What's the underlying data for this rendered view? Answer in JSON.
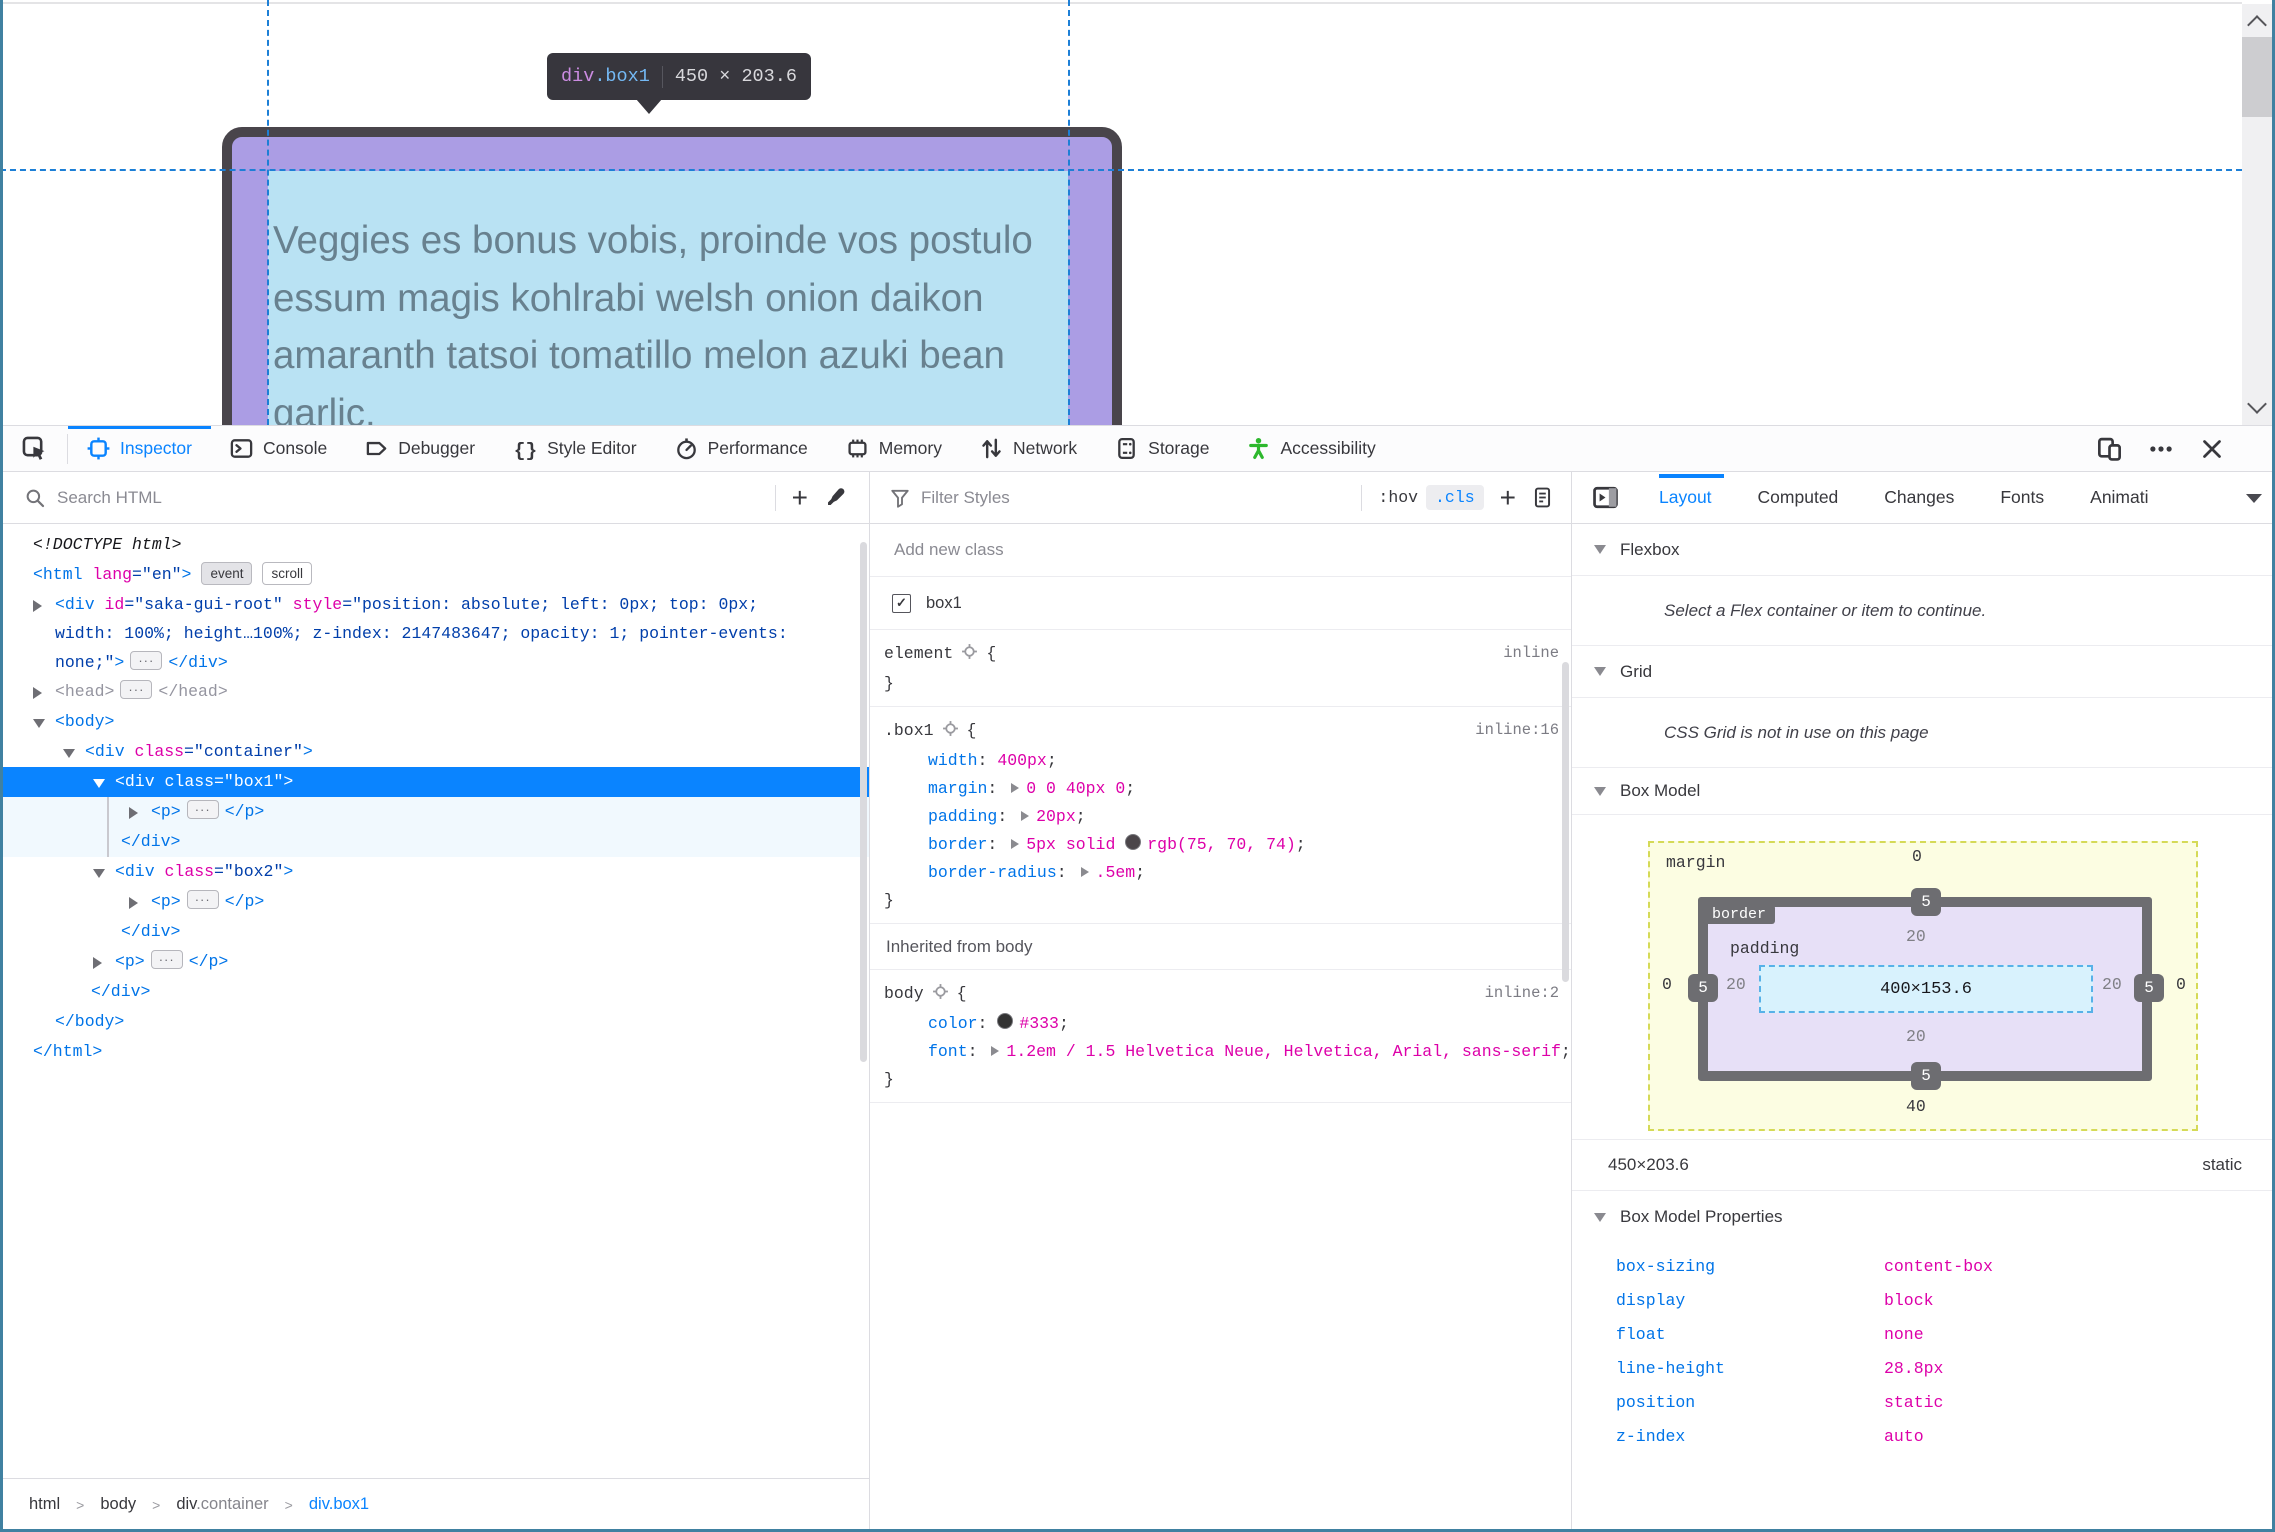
{
  "colors": {
    "accent": "#0a84ff",
    "tag_blue": "#0074e8",
    "attr_magenta": "#dd00a9",
    "value_navy": "#003eaa",
    "selection_bg": "#0a84ff",
    "guide_blue": "#1d7fd6",
    "highlight_padding": "#ab9de4",
    "highlight_content": "#b9e2f3",
    "element_border": "#4b464a",
    "window_edge": "#4081a1",
    "margin_fill": "#fcfde2",
    "padding_fill": "#e7e0f7",
    "content_fill": "#d8f2fd",
    "a11y_green": "#2db82d"
  },
  "page": {
    "tooltip": {
      "tag": "div",
      "class": ".box1",
      "dimensions": "450 × 203.6"
    },
    "box_text_lines": [
      "Veggies es bonus vobis, proinde vos postulo",
      "essum magis kohlrabi welsh onion daikon",
      "amaranth tatsoi tomatillo melon azuki bean",
      "garlic."
    ]
  },
  "tabbar": {
    "tabs": [
      {
        "id": "inspector",
        "label": "Inspector",
        "active": true
      },
      {
        "id": "console",
        "label": "Console",
        "active": false
      },
      {
        "id": "debugger",
        "label": "Debugger",
        "active": false
      },
      {
        "id": "style-editor",
        "label": "Style Editor",
        "active": false
      },
      {
        "id": "performance",
        "label": "Performance",
        "active": false
      },
      {
        "id": "memory",
        "label": "Memory",
        "active": false
      },
      {
        "id": "network",
        "label": "Network",
        "active": false
      },
      {
        "id": "storage",
        "label": "Storage",
        "active": false
      },
      {
        "id": "accessibility",
        "label": "Accessibility",
        "active": false
      }
    ]
  },
  "markup": {
    "search_placeholder": "Search HTML",
    "tree": [
      {
        "indent": 30,
        "parts": [
          {
            "k": "doctype",
            "v": "<!DOCTYPE html>"
          }
        ]
      },
      {
        "indent": 30,
        "parts": [
          {
            "k": "tag",
            "v": "<html"
          },
          {
            "k": "attr",
            "v": " lang"
          },
          {
            "k": "val",
            "v": "=\"en\""
          },
          {
            "k": "tag",
            "v": ">"
          },
          {
            "k": "badge",
            "v": "event"
          },
          {
            "k": "badge_o",
            "v": "scroll"
          }
        ]
      },
      {
        "indent": 52,
        "arrow": "c",
        "wrap": true,
        "parts": [
          {
            "k": "tag",
            "v": "<div"
          },
          {
            "k": "attr",
            "v": " id"
          },
          {
            "k": "val",
            "v": "=\"saka-gui-root\""
          },
          {
            "k": "attr",
            "v": " style"
          },
          {
            "k": "val",
            "v": "=\"position: absolute; left: 0px; top: 0px; width: 100%; height…100%; z-index: 2147483647; opacity: 1; pointer-events: none;\""
          },
          {
            "k": "tag",
            "v": ">"
          },
          {
            "k": "ellipsis"
          },
          {
            "k": "tag",
            "v": "</div>"
          }
        ]
      },
      {
        "indent": 52,
        "arrow": "c",
        "dim": true,
        "parts": [
          {
            "k": "tag",
            "v": "<head>"
          },
          {
            "k": "ellipsis"
          },
          {
            "k": "tag",
            "v": "</head>"
          }
        ]
      },
      {
        "indent": 52,
        "arrow": "e",
        "parts": [
          {
            "k": "tag",
            "v": "<body>"
          }
        ]
      },
      {
        "indent": 82,
        "arrow": "e",
        "parts": [
          {
            "k": "tag",
            "v": "<div"
          },
          {
            "k": "attr",
            "v": " class"
          },
          {
            "k": "val",
            "v": "=\"container\""
          },
          {
            "k": "tag",
            "v": ">"
          }
        ]
      },
      {
        "indent": 112,
        "arrow": "e",
        "sel": true,
        "parts": [
          {
            "k": "tag",
            "v": "<div"
          },
          {
            "k": "attr",
            "v": " class"
          },
          {
            "k": "val",
            "v": "=\"box1\""
          },
          {
            "k": "tag",
            "v": ">"
          }
        ]
      },
      {
        "indent": 148,
        "arrow": "c",
        "child": true,
        "parts": [
          {
            "k": "tag",
            "v": "<p>"
          },
          {
            "k": "ellipsis"
          },
          {
            "k": "tag",
            "v": "</p>"
          }
        ]
      },
      {
        "indent": 118,
        "child": true,
        "parts": [
          {
            "k": "tag",
            "v": "</div>"
          }
        ]
      },
      {
        "indent": 112,
        "arrow": "e",
        "parts": [
          {
            "k": "tag",
            "v": "<div"
          },
          {
            "k": "attr",
            "v": " class"
          },
          {
            "k": "val",
            "v": "=\"box2\""
          },
          {
            "k": "tag",
            "v": ">"
          }
        ]
      },
      {
        "indent": 148,
        "arrow": "c",
        "parts": [
          {
            "k": "tag",
            "v": "<p>"
          },
          {
            "k": "ellipsis"
          },
          {
            "k": "tag",
            "v": "</p>"
          }
        ]
      },
      {
        "indent": 118,
        "parts": [
          {
            "k": "tag",
            "v": "</div>"
          }
        ]
      },
      {
        "indent": 112,
        "arrow": "c",
        "parts": [
          {
            "k": "tag",
            "v": "<p>"
          },
          {
            "k": "ellipsis"
          },
          {
            "k": "tag",
            "v": "</p>"
          }
        ]
      },
      {
        "indent": 88,
        "parts": [
          {
            "k": "tag",
            "v": "</div>"
          }
        ]
      },
      {
        "indent": 52,
        "parts": [
          {
            "k": "tag",
            "v": "</body>"
          }
        ]
      },
      {
        "indent": 30,
        "parts": [
          {
            "k": "tag",
            "v": "</html>"
          }
        ]
      }
    ],
    "breadcrumbs": [
      {
        "tag": "html",
        "cls": "",
        "sel": false
      },
      {
        "tag": "body",
        "cls": "",
        "sel": false
      },
      {
        "tag": "div",
        "cls": ".container",
        "sel": false
      },
      {
        "tag": "div",
        "cls": ".box1",
        "sel": true
      }
    ]
  },
  "rules": {
    "filter_placeholder": "Filter Styles",
    "hov_label": ":hov",
    "cls_label": ".cls",
    "add_class_placeholder": "Add new class",
    "class_toggle": {
      "label": "box1",
      "checked": true
    },
    "sections": [
      {
        "type": "rule",
        "selector": "element",
        "link": "inline",
        "declarations": []
      },
      {
        "type": "rule",
        "selector": ".box1",
        "link": "inline:16",
        "declarations": [
          {
            "name": "width",
            "segments": [
              {
                "text": "400px"
              }
            ]
          },
          {
            "name": "margin",
            "arrow": true,
            "segments": [
              {
                "text": "0 0 40px 0"
              }
            ]
          },
          {
            "name": "padding",
            "arrow": true,
            "segments": [
              {
                "text": "20px"
              }
            ]
          },
          {
            "name": "border",
            "arrow": true,
            "segments": [
              {
                "text": "5px solid "
              },
              {
                "swatch": "#4b464a"
              },
              {
                "text": "rgb(75, 70, 74)"
              }
            ]
          },
          {
            "name": "border-radius",
            "arrow": true,
            "segments": [
              {
                "text": ".5em"
              }
            ]
          }
        ]
      },
      {
        "type": "header",
        "label": "Inherited from body"
      },
      {
        "type": "rule",
        "selector": "body",
        "link": "inline:2",
        "declarations": [
          {
            "name": "color",
            "segments": [
              {
                "swatch": "#333333"
              },
              {
                "text": "#333"
              }
            ]
          },
          {
            "name": "font",
            "arrow": true,
            "segments": [
              {
                "text": "1.2em / 1.5 Helvetica Neue, Helvetica, Arial, sans-serif"
              }
            ]
          }
        ]
      }
    ]
  },
  "layout": {
    "tabs": [
      "Layout",
      "Computed",
      "Changes",
      "Fonts",
      "Animati"
    ],
    "flexbox": {
      "title": "Flexbox",
      "message": "Select a Flex container or item to continue."
    },
    "grid": {
      "title": "Grid",
      "message": "CSS Grid is not in use on this page"
    },
    "boxmodel_title": "Box Model",
    "diagram": {
      "margin_label": "margin",
      "border_label": "border",
      "padding_label": "padding",
      "content": "400×153.6",
      "margin": {
        "top": "0",
        "right": "0",
        "bottom": "40",
        "left": "0"
      },
      "border": {
        "top": "5",
        "right": "5",
        "bottom": "5",
        "left": "5"
      },
      "padding": {
        "top": "20",
        "right": "20",
        "bottom": "20",
        "left": "20"
      }
    },
    "size_row": {
      "dimensions": "450×203.6",
      "position": "static"
    },
    "properties_title": "Box Model Properties",
    "properties": [
      [
        "box-sizing",
        "content-box"
      ],
      [
        "display",
        "block"
      ],
      [
        "float",
        "none"
      ],
      [
        "line-height",
        "28.8px"
      ],
      [
        "position",
        "static"
      ],
      [
        "z-index",
        "auto"
      ]
    ]
  }
}
